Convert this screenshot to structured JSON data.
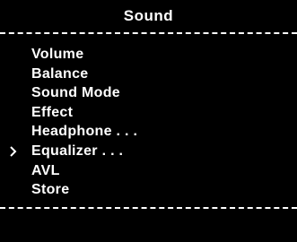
{
  "menu": {
    "title": "Sound",
    "items": [
      {
        "label": "Volume",
        "selected": false
      },
      {
        "label": "Balance",
        "selected": false
      },
      {
        "label": "Sound Mode",
        "selected": false
      },
      {
        "label": "Effect",
        "selected": false
      },
      {
        "label": "Headphone . . .",
        "selected": false
      },
      {
        "label": "Equalizer . . .",
        "selected": true
      },
      {
        "label": "AVL",
        "selected": false
      },
      {
        "label": "Store",
        "selected": false
      }
    ],
    "cursor_icon": "chevron-right-icon",
    "colors": {
      "background": "#000000",
      "foreground": "#ffffff"
    }
  }
}
